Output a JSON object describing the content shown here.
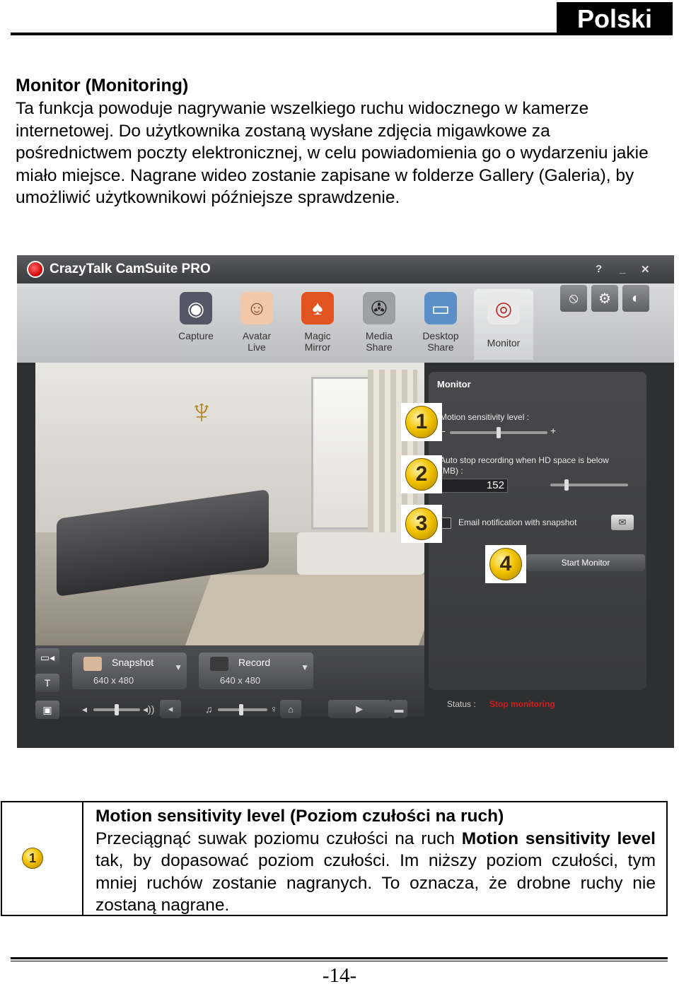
{
  "header": {
    "language": "Polski"
  },
  "intro": {
    "title": "Monitor (Monitoring)",
    "paragraph": "Ta funkcja powoduje nagrywanie wszelkiego ruchu widocznego w kamerze internetowej. Do użytkownika zostaną wysłane zdjęcia migawkowe za pośrednictwem poczty elektronicznej, w celu powiadomienia go o wydarzeniu jakie miało miejsce. Nagrane wideo zostanie zapisane w folderze Gallery (Galeria), by umożliwić użytkownikowi późniejsze sprawdzenie."
  },
  "app": {
    "title": "CrazyTalk CamSuite PRO",
    "window_buttons": [
      "?",
      "_",
      "✕"
    ],
    "tools": [
      {
        "label": "Capture",
        "icon": "camera-icon"
      },
      {
        "label": "Avatar\nLive",
        "icon": "avatar-icon"
      },
      {
        "label": "Magic\nMirror",
        "icon": "mask-icon"
      },
      {
        "label": "Media\nShare",
        "icon": "film-reel-icon"
      },
      {
        "label": "Desktop\nShare",
        "icon": "desktop-icon"
      },
      {
        "label": "Monitor",
        "icon": "security-camera-icon"
      }
    ],
    "capture": {
      "snapshot_label": "Snapshot",
      "snapshot_res": "640 x 480",
      "record_label": "Record",
      "record_res": "640 x 480"
    },
    "panel": {
      "title": "Monitor",
      "sensitivity_label": "Motion sensitivity level :",
      "autostop_label": "Auto stop recording when HD space is below (MB) :",
      "autostop_value": "152",
      "email_label": "Email notification with snapshot",
      "start_label": "Start Monitor"
    },
    "status_label": "Status :",
    "status_value": "Stop monitoring",
    "badges": [
      "1",
      "2",
      "3",
      "4"
    ]
  },
  "info": {
    "badge": "1",
    "title": "Motion sensitivity level (Poziom czułości na ruch)",
    "text_before": "Przeciągnąć suwak poziomu czułości na ruch ",
    "bold_term": "Motion sensitivity level",
    "text_after": " tak, by dopasować poziom czułości. Im niższy poziom czułości, tym mniej ruchów zostanie nagranych. To oznacza, że drobne ruchy nie zostaną nagrane."
  },
  "footer": {
    "page": "-14-"
  }
}
